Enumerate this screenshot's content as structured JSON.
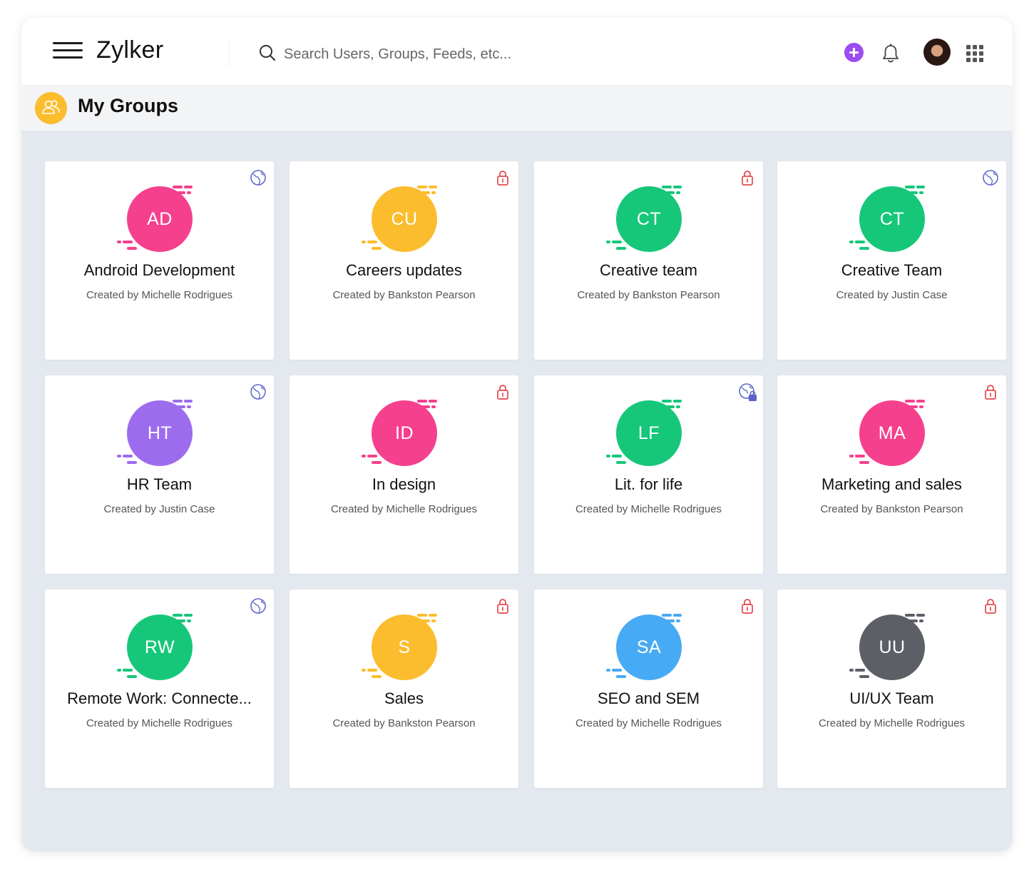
{
  "app": {
    "brand": "Zylker",
    "search_placeholder": "Search Users, Groups, Feeds, etc..."
  },
  "header": {
    "title": "My Groups"
  },
  "colors": {
    "accent_purple": "#9c4cf0",
    "globe_blue": "#5a63c8",
    "lock_red": "#e5484d"
  },
  "groups": [
    {
      "initials": "AD",
      "name": "Android Development",
      "creator": "Created by Michelle Rodrigues",
      "color": "#f5408d",
      "privacy": "public"
    },
    {
      "initials": "CU",
      "name": "Careers updates",
      "creator": "Created by Bankston Pearson",
      "color": "#fbbd2d",
      "privacy": "private"
    },
    {
      "initials": "CT",
      "name": "Creative team",
      "creator": "Created by Bankston Pearson",
      "color": "#16c77a",
      "privacy": "private"
    },
    {
      "initials": "CT",
      "name": "Creative Team",
      "creator": "Created by Justin Case",
      "color": "#16c77a",
      "privacy": "public"
    },
    {
      "initials": "HT",
      "name": "HR Team",
      "creator": "Created by Justin Case",
      "color": "#9d6cee",
      "privacy": "public"
    },
    {
      "initials": "ID",
      "name": "In design",
      "creator": "Created by Michelle Rodrigues",
      "color": "#f5408d",
      "privacy": "private"
    },
    {
      "initials": "LF",
      "name": "Lit. for life",
      "creator": "Created by Michelle Rodrigues",
      "color": "#16c77a",
      "privacy": "public-locked"
    },
    {
      "initials": "MA",
      "name": "Marketing and sales",
      "creator": "Created by Bankston Pearson",
      "color": "#f5408d",
      "privacy": "private"
    },
    {
      "initials": "RW",
      "name": "Remote Work: Connecte...",
      "creator": "Created by Michelle Rodrigues",
      "color": "#16c77a",
      "privacy": "public"
    },
    {
      "initials": "S",
      "name": "Sales",
      "creator": "Created by Bankston Pearson",
      "color": "#fbbd2d",
      "privacy": "private"
    },
    {
      "initials": "SA",
      "name": "SEO and SEM",
      "creator": "Created by Michelle Rodrigues",
      "color": "#47aaf5",
      "privacy": "private"
    },
    {
      "initials": "UU",
      "name": "UI/UX Team",
      "creator": "Created by Michelle Rodrigues",
      "color": "#5c5f66",
      "privacy": "private"
    }
  ]
}
